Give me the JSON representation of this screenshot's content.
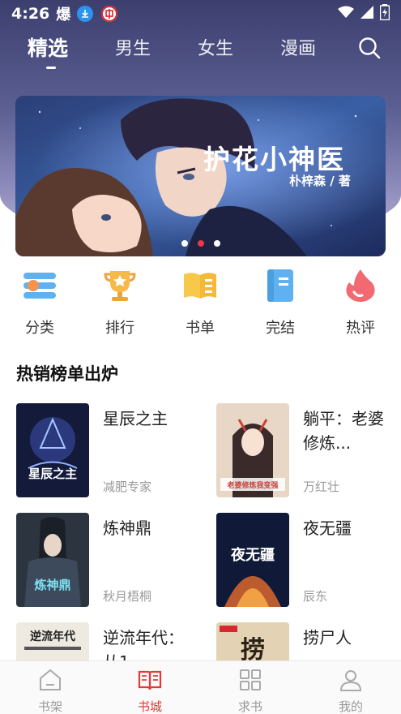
{
  "status_bar": {
    "time": "4:26",
    "glyph": "爆"
  },
  "top_tabs": [
    {
      "label": "精选",
      "active": true
    },
    {
      "label": "男生"
    },
    {
      "label": "女生"
    },
    {
      "label": "漫画"
    }
  ],
  "banner": {
    "title": "护花小神医",
    "author": "朴梓森 / 著",
    "dots": 3,
    "active_dot": 1
  },
  "categories": [
    {
      "label": "分类",
      "icon": "category-icon"
    },
    {
      "label": "排行",
      "icon": "trophy-icon"
    },
    {
      "label": "书单",
      "icon": "book-list-icon"
    },
    {
      "label": "完结",
      "icon": "finished-book-icon"
    },
    {
      "label": "热评",
      "icon": "flame-icon"
    }
  ],
  "section": {
    "title": "热销榜单出炉"
  },
  "books": [
    {
      "title": "星辰之主",
      "author": "减肥专家",
      "cover_text": "星辰之主"
    },
    {
      "title": "躺平：老婆修炼...",
      "author": "万红壮",
      "cover_text": "老婆修炼我变强"
    },
    {
      "title": "炼神鼎",
      "author": "秋月梧桐",
      "cover_text": "炼神鼎"
    },
    {
      "title": "夜无疆",
      "author": "辰东",
      "cover_text": "夜无疆"
    },
    {
      "title": "逆流年代：从1",
      "author": "",
      "cover_text": "逆流年代"
    },
    {
      "title": "捞尸人",
      "author": "",
      "cover_text": "捞"
    }
  ],
  "bottom_nav": [
    {
      "label": "书架",
      "icon": "bookshelf-icon"
    },
    {
      "label": "书城",
      "icon": "bookstore-icon",
      "active": true
    },
    {
      "label": "求书",
      "icon": "request-book-icon"
    },
    {
      "label": "我的",
      "icon": "profile-icon"
    }
  ],
  "colors": {
    "accent": "#e23a3a",
    "header": "#4a4d80"
  }
}
